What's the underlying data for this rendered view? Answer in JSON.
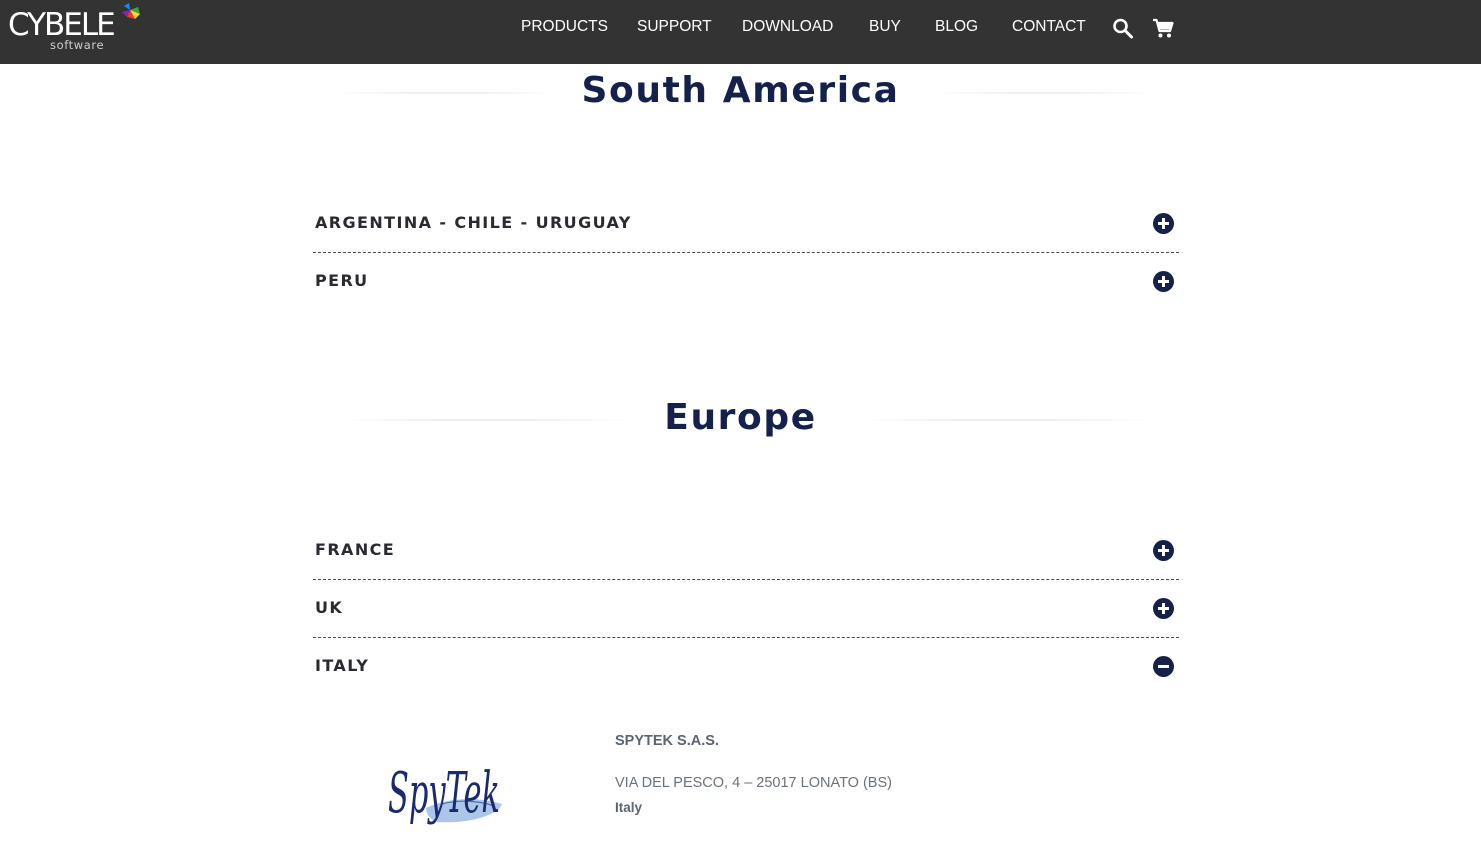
{
  "header": {
    "logo": {
      "wordmark": "CYBELE",
      "subtitle": "software"
    },
    "nav": [
      {
        "label": "PRODUCTS"
      },
      {
        "label": "SUPPORT"
      },
      {
        "label": "DOWNLOAD"
      },
      {
        "label": "BUY"
      },
      {
        "label": "BLOG"
      },
      {
        "label": "CONTACT"
      }
    ],
    "icons": [
      "search-icon",
      "cart-icon"
    ]
  },
  "colors": {
    "header_bg": "#333333",
    "heading": "#15214a",
    "toggle_bg": "#15214a",
    "accordion_text": "#2a2a33",
    "partner_text": "#5d6570"
  },
  "sections": [
    {
      "title": "South America",
      "items": [
        {
          "label": "ARGENTINA - CHILE - URUGUAY",
          "expanded": false
        },
        {
          "label": "PERU",
          "expanded": false
        }
      ]
    },
    {
      "title": "Europe",
      "items": [
        {
          "label": "FRANCE",
          "expanded": false
        },
        {
          "label": "UK",
          "expanded": false
        },
        {
          "label": "ITALY",
          "expanded": true
        }
      ]
    }
  ],
  "italy_partner": {
    "logo_text": "SpyTek",
    "name": "SPYTEK S.A.S.",
    "address": "VIA DEL PESCO, 4 – 25017 LONATO (BS)",
    "country": "Italy"
  }
}
